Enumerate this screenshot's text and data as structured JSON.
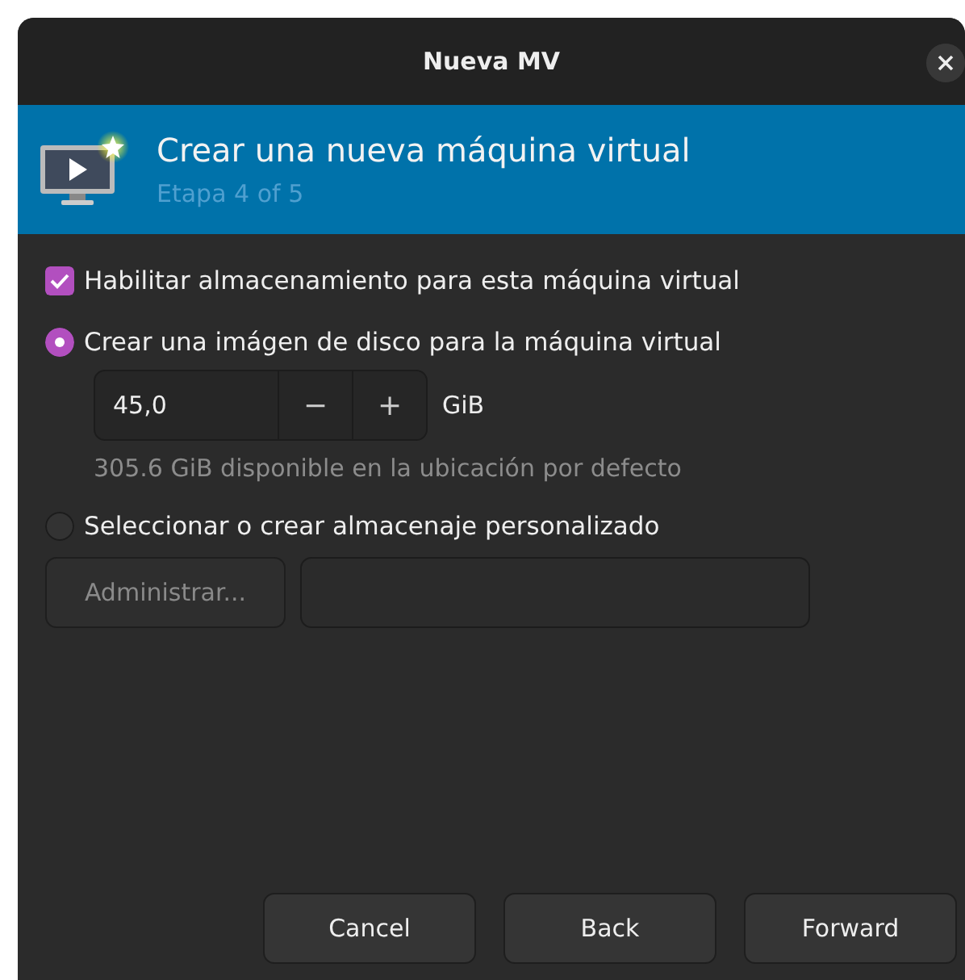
{
  "window": {
    "title": "Nueva MV"
  },
  "banner": {
    "title": "Crear una nueva máquina virtual",
    "subtitle": "Etapa 4 of 5"
  },
  "storage": {
    "enable": {
      "label": "Habilitar almacenamiento para esta máquina virtual",
      "checked": true
    },
    "disk_image": {
      "label": "Crear una imágen de disco para la máquina virtual",
      "selected": true,
      "size": {
        "value": "45,0",
        "decrement": "−",
        "increment": "+",
        "unit": "GiB"
      },
      "hint": "305.6 GiB disponible en la ubicación por defecto"
    },
    "custom": {
      "label": "Seleccionar o crear almacenaje personalizado",
      "selected": false,
      "manage_button": {
        "label": "Administrar...",
        "disabled": true
      }
    }
  },
  "buttons": [
    {
      "label": "Cancel"
    },
    {
      "label": "Back"
    },
    {
      "label": "Forward"
    }
  ]
}
